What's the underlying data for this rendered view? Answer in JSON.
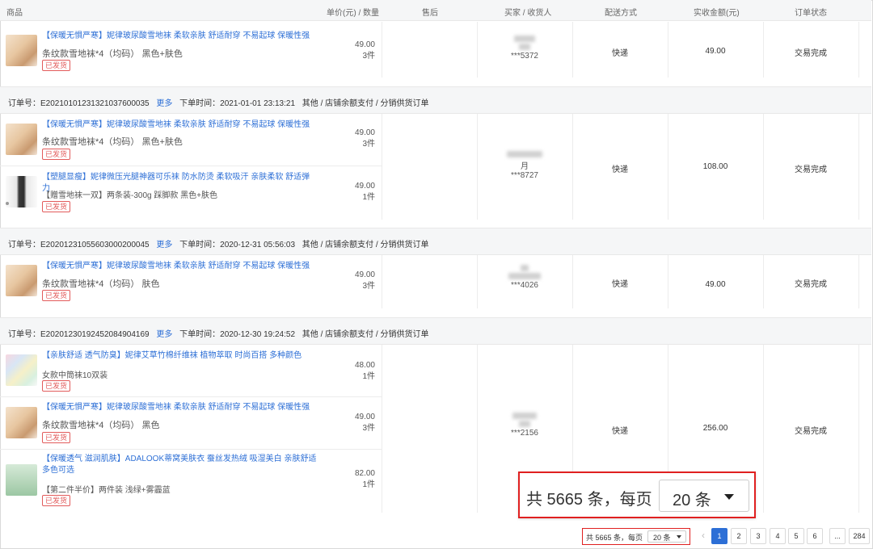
{
  "header": {
    "goods": "商品",
    "price_qty": "单价(元) / 数量",
    "after_sale": "售后",
    "buyer": "买家 / 收货人",
    "shipping": "配送方式",
    "amount": "实收金额(元)",
    "status": "订单状态"
  },
  "orders": [
    {
      "items": [
        {
          "title": "【保暖无惧严寒】妮律玻尿酸雪地袜 柔软亲肤 舒适耐穿 不易起球 保暖性强",
          "spec": "条纹款雪地袜*4（均码） 黑色+肤色",
          "tag": "已发货",
          "price": "49.00",
          "qty": "3件"
        }
      ],
      "buyer_suffix": "***5372",
      "shipping": "快递",
      "amount": "49.00",
      "status": "交易完成"
    },
    {
      "order_no": "订单号：E20210101231321037600035",
      "more": "更多",
      "time": "下单时间：2021-01-01 23:13:21",
      "meta": "其他 / 店铺余额支付 / 分销供货订单",
      "items": [
        {
          "title": "【保暖无惧严寒】妮律玻尿酸雪地袜 柔软亲肤 舒适耐穿 不易起球 保暖性强",
          "spec": "条纹款雪地袜*4（均码） 黑色+肤色",
          "tag": "已发货",
          "price": "49.00",
          "qty": "3件"
        },
        {
          "title": "【塑腿显瘦】妮律微压光腿神器可乐袜 防水防烫 柔软吸汗 亲肤柔软 舒适弹力",
          "spec": "【赠雪地袜一双】两条装-300g 踩脚款 黑色+肤色",
          "tag": "已发货",
          "price": "49.00",
          "qty": "1件"
        }
      ],
      "buyer_top": "月",
      "buyer_suffix": "***8727",
      "shipping": "快递",
      "amount": "108.00",
      "status": "交易完成"
    },
    {
      "order_no": "订单号：E20201231055603000200045",
      "more": "更多",
      "time": "下单时间：2020-12-31 05:56:03",
      "meta": "其他 / 店铺余额支付 / 分销供货订单",
      "items": [
        {
          "title": "【保暖无惧严寒】妮律玻尿酸雪地袜 柔软亲肤 舒适耐穿 不易起球 保暖性强",
          "spec": "条纹款雪地袜*4（均码） 肤色",
          "tag": "已发货",
          "price": "49.00",
          "qty": "3件"
        }
      ],
      "buyer_suffix": "***4026",
      "shipping": "快递",
      "amount": "49.00",
      "status": "交易完成"
    },
    {
      "order_no": "订单号：E20201230192452084904169",
      "more": "更多",
      "time": "下单时间：2020-12-30 19:24:52",
      "meta": "其他 / 店铺余额支付 / 分销供货订单",
      "items": [
        {
          "title": "【亲肤舒适 透气防臭】妮律艾草竹棉纤维袜 植物萃取 时尚百搭 多种颜色",
          "spec": "女款中筒袜10双装",
          "tag": "已发货",
          "price": "48.00",
          "qty": "1件"
        },
        {
          "title": "【保暖无惧严寒】妮律玻尿酸雪地袜 柔软亲肤 舒适耐穿 不易起球 保暖性强",
          "spec": "条纹款雪地袜*4（均码） 黑色",
          "tag": "已发货",
          "price": "49.00",
          "qty": "3件"
        },
        {
          "title": "【保暖透气 滋润肌肤】ADALOOK蒂窝美肤衣 蚕丝发热绒 吸湿美白 亲肤舒适 多色可选",
          "spec": "【第二件半价】两件装 浅绿+雾霾蓝",
          "tag": "已发货",
          "price": "82.00",
          "qty": "1件"
        }
      ],
      "buyer_suffix": "***2156",
      "shipping": "快递",
      "amount": "256.00",
      "status": "交易完成"
    }
  ],
  "pagination": {
    "total_text": "共 5665 条，每页",
    "page_size": "20 条",
    "pages": [
      "1",
      "2",
      "3",
      "4",
      "5",
      "6",
      "...",
      "284"
    ],
    "current_page": "1",
    "prev": "‹"
  },
  "zoom_callout": {
    "total_text": "共 5665 条，每页",
    "page_size": "20 条"
  },
  "colors": {
    "link": "#2d6fd6",
    "tag": "#e25b5b",
    "highlight": "#e02020",
    "header_bg": "#f5f6f7"
  }
}
